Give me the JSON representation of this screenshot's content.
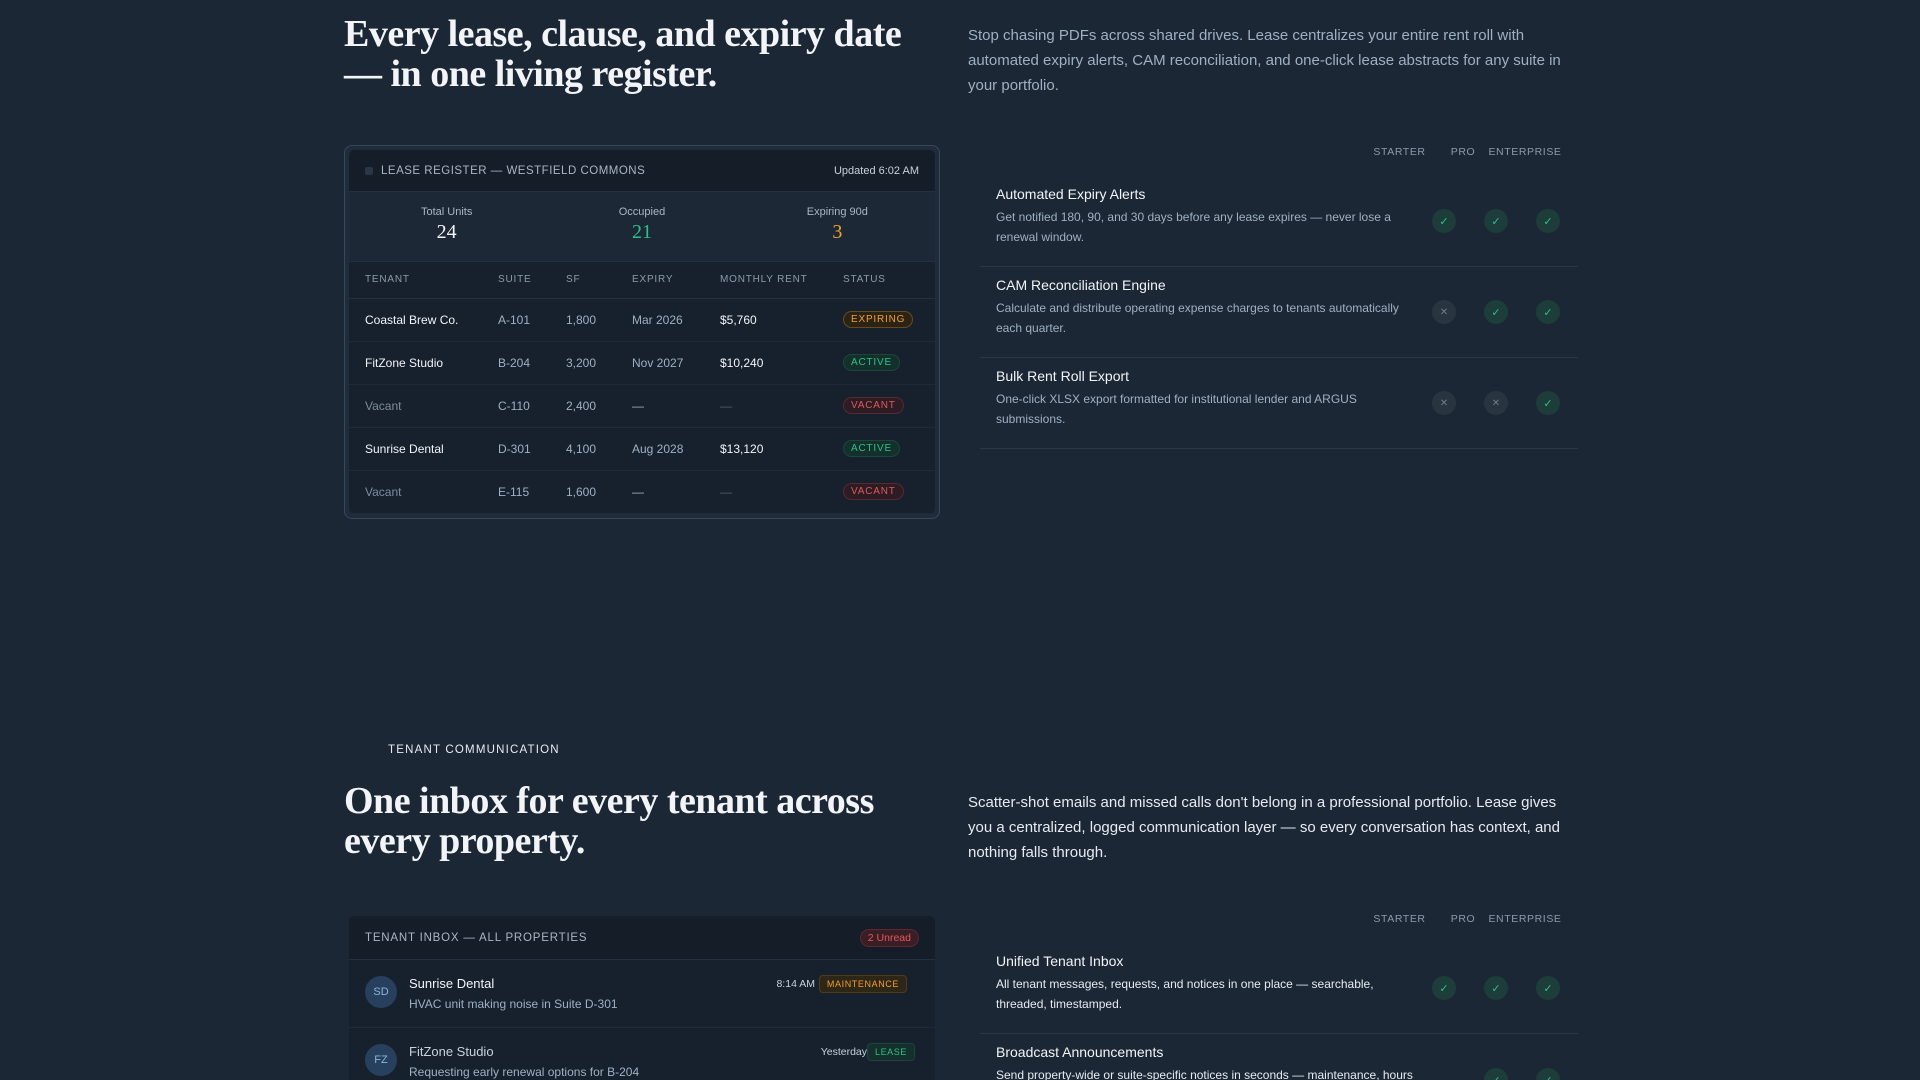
{
  "section1": {
    "headline": "Every lease, clause, and expiry date — in one living register.",
    "lead": "Stop chasing PDFs across shared drives. Lease centralizes your entire rent roll with automated expiry alerts, CAM reconciliation, and one-click lease abstracts for any suite in your portfolio.",
    "register": {
      "title": "LEASE REGISTER — WESTFIELD COMMONS",
      "updated": "Updated 6:02 AM",
      "stats": [
        {
          "label": "Total Units",
          "value": "24"
        },
        {
          "label": "Occupied",
          "value": "21"
        },
        {
          "label": "Expiring 90d",
          "value": "3"
        }
      ],
      "columns": [
        "TENANT",
        "SUITE",
        "SF",
        "EXPIRY",
        "MONTHLY RENT",
        "STATUS"
      ],
      "rows": [
        {
          "tenant": "Coastal Brew Co.",
          "suite": "A-101",
          "sf": "1,800",
          "expiry": "Mar 2026",
          "rent": "$5,760",
          "status": "EXPIRING"
        },
        {
          "tenant": "FitZone Studio",
          "suite": "B-204",
          "sf": "3,200",
          "expiry": "Nov 2027",
          "rent": "$10,240",
          "status": "ACTIVE"
        },
        {
          "tenant": "Vacant",
          "suite": "C-110",
          "sf": "2,400",
          "expiry": "—",
          "rent": "—",
          "status": "VACANT"
        },
        {
          "tenant": "Sunrise Dental",
          "suite": "D-301",
          "sf": "4,100",
          "expiry": "Aug 2028",
          "rent": "$13,120",
          "status": "ACTIVE"
        },
        {
          "tenant": "Vacant",
          "suite": "E-115",
          "sf": "1,600",
          "expiry": "—",
          "rent": "—",
          "status": "VACANT"
        }
      ]
    },
    "tiers": [
      "STARTER",
      "PRO",
      "ENTERPRISE"
    ],
    "features": [
      {
        "title": "Automated Expiry Alerts",
        "desc": "Get notified 180, 90, and 30 days before any lease expires — never lose a renewal window.",
        "starter": true,
        "pro": true,
        "enterprise": true
      },
      {
        "title": "CAM Reconciliation Engine",
        "desc": "Calculate and distribute operating expense charges to tenants automatically each quarter.",
        "starter": false,
        "pro": true,
        "enterprise": true
      },
      {
        "title": "Bulk Rent Roll Export",
        "desc": "One-click XLSX export formatted for institutional lender and ARGUS submissions.",
        "starter": false,
        "pro": false,
        "enterprise": true
      }
    ]
  },
  "section2": {
    "eyebrow": "TENANT COMMUNICATION",
    "headline": "One inbox for every tenant across every property.",
    "lead": "Scatter-shot emails and missed calls don't belong in a professional portfolio. Lease gives you a centralized, logged communication layer — so every conversation has context, and nothing falls through.",
    "inbox": {
      "title": "TENANT INBOX — ALL PROPERTIES",
      "unread": "2 Unread",
      "messages": [
        {
          "initials": "SD",
          "name": "Sunrise Dental",
          "text": "HVAC unit making noise in Suite D-301",
          "time": "8:14 AM",
          "tag": "MAINTENANCE"
        },
        {
          "initials": "FZ",
          "name": "FitZone Studio",
          "text": "Requesting early renewal options for B-204",
          "time": "Yesterday",
          "tag": "LEASE"
        }
      ]
    },
    "tiers": [
      "STARTER",
      "PRO",
      "ENTERPRISE"
    ],
    "features": [
      {
        "title": "Unified Tenant Inbox",
        "desc": "All tenant messages, requests, and notices in one place — searchable, threaded, timestamped.",
        "starter": true,
        "pro": true,
        "enterprise": true
      },
      {
        "title": "Broadcast Announcements",
        "desc": "Send property-wide or suite-specific notices in seconds — maintenance, hours",
        "pro": true,
        "enterprise": true
      }
    ]
  },
  "icons": {
    "check": "check-icon",
    "cross": "cross-icon",
    "lock": "register-icon"
  },
  "colors": {
    "background": "#1b2735",
    "green": "#2fc08a",
    "amber": "#f1a02b",
    "red": "#e5575a"
  }
}
